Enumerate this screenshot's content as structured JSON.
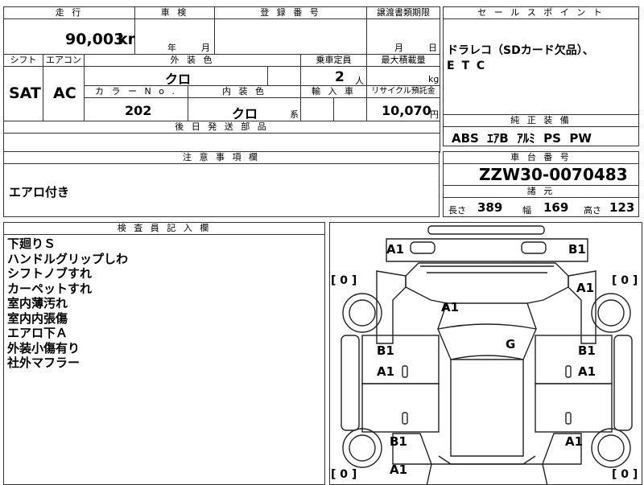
{
  "top": {
    "mileage_label": "走 行",
    "mileage_value": "90,003",
    "mileage_unit": "km",
    "inspection_label": "車 検",
    "inspection_year": "年",
    "inspection_month": "月",
    "registration_label": "登 録 番 号",
    "transfer_label": "譲渡書類期限",
    "transfer_month": "月",
    "transfer_day": "日",
    "shift_label": "シフト",
    "ac_label": "エアコン",
    "color_label": "外 装 色",
    "capacity_label": "乗車定員",
    "loadmax_label": "最大積載量",
    "shift_value": "SAT",
    "ac_value": "AC",
    "color_value": "クロ",
    "capacity_value": "2",
    "capacity_unit": "人",
    "load_unit": "kg",
    "colorno_label": "カ ラ ー N o .",
    "interior_label": "内 装 色",
    "import_label": "輸 入 車",
    "recycle_label": "リサイクル預託金",
    "colorno_value": "202",
    "interior_value": "クロ",
    "interior_suffix": "系",
    "recycle_value": "10,070",
    "recycle_unit": "円",
    "later_parts_label": "後 日 発 送 部 品"
  },
  "sales": {
    "header": "セ ー ル ス ポ イ ン ト",
    "line1": "ドラレコ（SDカード欠品）、",
    "line2": "E T C"
  },
  "equipment": {
    "header": "純 正 装 備",
    "items": "ABS  ｴｱB  ｱﾙﾐ  PS  PW"
  },
  "notes": {
    "header": "注 意 事 項 欄",
    "text": "エアロ付き"
  },
  "chassis": {
    "header": "車 台 番 号",
    "value": "ZZW30-0070483",
    "specs_header": "諸 元",
    "length_label": "長さ",
    "length_value": "389",
    "width_label": "幅",
    "width_value": "169",
    "height_label": "高さ",
    "height_value": "123"
  },
  "inspector": {
    "header": "検 査 員 記 入 欄",
    "lines": [
      "下廻りＳ",
      "ハンドルグリップしわ",
      "シフトノブすれ",
      "カーペットすれ",
      "室内薄汚れ",
      "室内内張傷",
      "エアロ下Ａ",
      "外装小傷有り",
      "社外マフラー"
    ]
  },
  "diagram": {
    "codes": {
      "a1_front_left": "A1",
      "b1_front_right": "B1",
      "a1_front_fender_right": "A1",
      "a1_hood": "A1",
      "g_windshield": "G",
      "b1_left_door_upper": "B1",
      "a1_left_door_lower": "A1",
      "b1_right_door_upper": "B1",
      "a1_right_door_lower": "A1",
      "b1_left_rear": "B1",
      "a1_right_rear": "A1",
      "a1_rear_left": "A1"
    },
    "tire_left_front": "[ 0 ]",
    "tire_right_front": "[ 0 ]",
    "tire_left_rear": "[ 0 ]",
    "tire_right_rear": "[ 0 ]",
    "zero_small": "0"
  }
}
